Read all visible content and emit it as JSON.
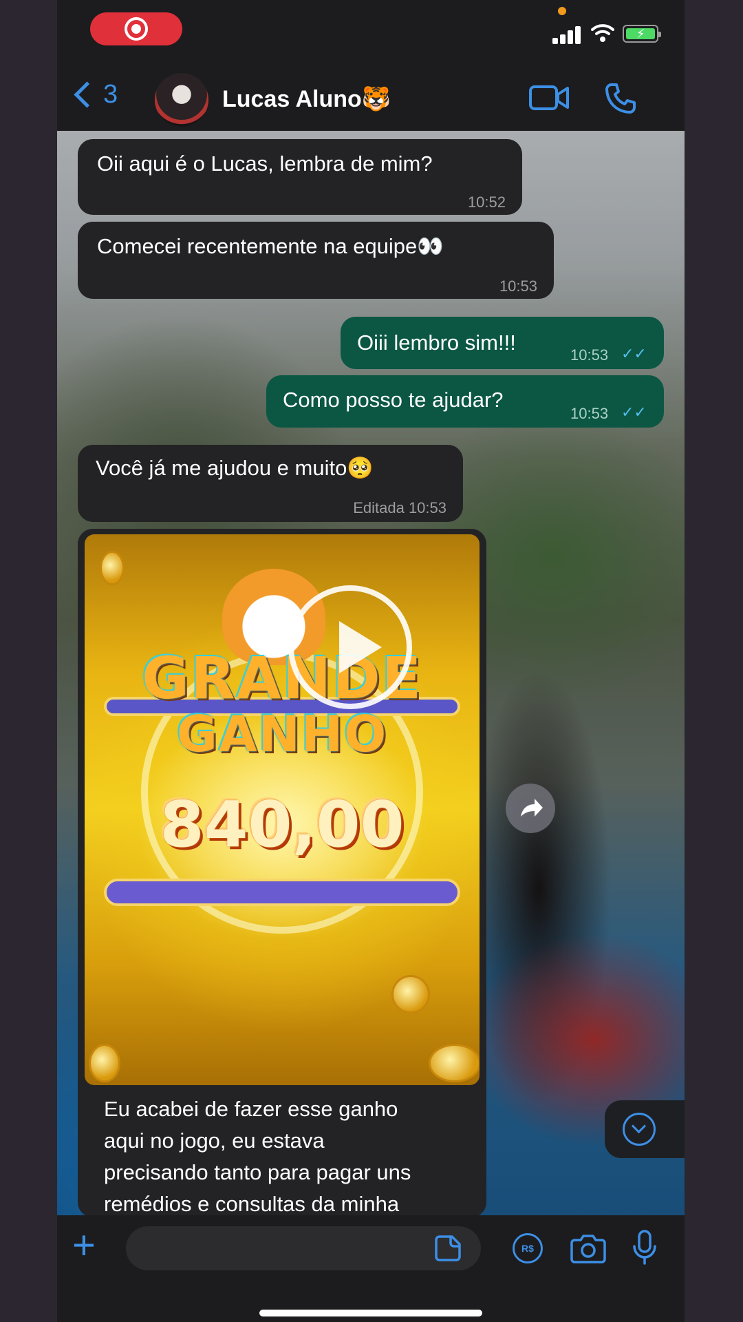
{
  "status_bar": {
    "icons": [
      "screen-record-icon",
      "signal-icon",
      "wifi-icon",
      "battery-charging-icon"
    ]
  },
  "header": {
    "back_count": "3",
    "contact_name": "Lucas Aluno🐯",
    "icons": [
      "back-chevron-icon",
      "video-call-icon",
      "phone-call-icon"
    ]
  },
  "messages": [
    {
      "direction": "in",
      "text": "Oii aqui é o Lucas, lembra de mim?",
      "time": "10:52"
    },
    {
      "direction": "in",
      "text": "Comecei recentemente na equipe👀",
      "time": "10:53"
    },
    {
      "direction": "out",
      "text": "Oiii lembro sim!!!",
      "time": "10:53",
      "status": "read"
    },
    {
      "direction": "out",
      "text": "Como posso te ajudar?",
      "time": "10:53",
      "status": "read"
    },
    {
      "direction": "in",
      "text": "Você já me ajudou e muito🥺",
      "time": "Editada 10:53"
    }
  ],
  "media_message": {
    "type": "video",
    "game_title_line1": "GRANDE",
    "game_title_line2": "GANHO",
    "win_amount": "840,00",
    "caption_lines": [
      "Eu acabei de fazer esse ganho",
      "aqui no jogo, eu estava",
      "precisando tanto para pagar uns",
      "remédios e consultas da minha"
    ]
  },
  "composer": {
    "placeholder": "",
    "icons": [
      "plus-icon",
      "sticker-icon",
      "payment-icon",
      "camera-icon",
      "microphone-icon"
    ]
  },
  "colors": {
    "accent": "#3d8fe6",
    "incoming_bubble": "#232325",
    "outgoing_bubble": "#0b5743",
    "read_ticks": "#53bdeb",
    "record_pill": "#e0303a"
  }
}
